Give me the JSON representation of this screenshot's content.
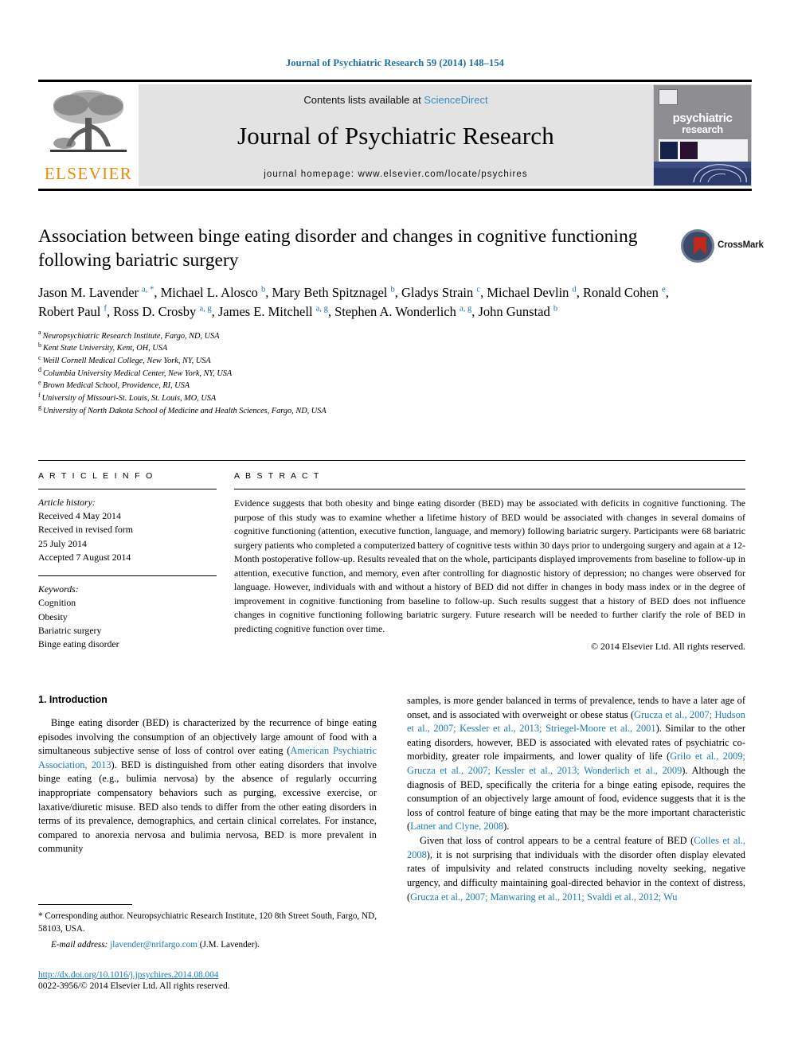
{
  "running_head": "Journal of Psychiatric Research 59 (2014) 148–154",
  "masthead": {
    "contents_prefix": "Contents lists available at ",
    "sciencedirect": "ScienceDirect",
    "journal_title": "Journal of Psychiatric Research",
    "homepage": "journal homepage: www.elsevier.com/locate/psychires",
    "publisher_wordmark": "ELSEVIER",
    "cover_title_line1": "psychiatric",
    "cover_title_line2": "research"
  },
  "article": {
    "title": "Association between binge eating disorder and changes in cognitive functioning following bariatric surgery",
    "crossmark_label": "CrossMark",
    "authors_html": "Jason M. Lavender <sup>a, *</sup>, Michael L. Alosco <sup>b</sup>, Mary Beth Spitznagel <sup>b</sup>, Gladys Strain <sup>c</sup>, Michael Devlin <sup>d</sup>, Ronald Cohen <sup>e</sup>, Robert Paul <sup>f</sup>, Ross D. Crosby <sup>a, g</sup>, James E. Mitchell <sup>a, g</sup>, Stephen A. Wonderlich <sup>a, g</sup>, John Gunstad <sup>b</sup>",
    "affiliations": [
      {
        "marker": "a",
        "text": "Neuropsychiatric Research Institute, Fargo, ND, USA"
      },
      {
        "marker": "b",
        "text": "Kent State University, Kent, OH, USA"
      },
      {
        "marker": "c",
        "text": "Weill Cornell Medical College, New York, NY, USA"
      },
      {
        "marker": "d",
        "text": "Columbia University Medical Center, New York, NY, USA"
      },
      {
        "marker": "e",
        "text": "Brown Medical School, Providence, RI, USA"
      },
      {
        "marker": "f",
        "text": "University of Missouri-St. Louis, St. Louis, MO, USA"
      },
      {
        "marker": "g",
        "text": "University of North Dakota School of Medicine and Health Sciences, Fargo, ND, USA"
      }
    ]
  },
  "article_info": {
    "heading": "A R T I C L E   I N F O",
    "history_label": "Article history:",
    "history_lines": [
      "Received 4 May 2014",
      "Received in revised form",
      "25 July 2014",
      "Accepted 7 August 2014"
    ],
    "keywords_label": "Keywords:",
    "keywords": [
      "Cognition",
      "Obesity",
      "Bariatric surgery",
      "Binge eating disorder"
    ]
  },
  "abstract": {
    "heading": "A B S T R A C T",
    "text": "Evidence suggests that both obesity and binge eating disorder (BED) may be associated with deficits in cognitive functioning. The purpose of this study was to examine whether a lifetime history of BED would be associated with changes in several domains of cognitive functioning (attention, executive function, language, and memory) following bariatric surgery. Participants were 68 bariatric surgery patients who completed a computerized battery of cognitive tests within 30 days prior to undergoing surgery and again at a 12-Month postoperative follow-up. Results revealed that on the whole, participants displayed improvements from baseline to follow-up in attention, executive function, and memory, even after controlling for diagnostic history of depression; no changes were observed for language. However, individuals with and without a history of BED did not differ in changes in body mass index or in the degree of improvement in cognitive functioning from baseline to follow-up. Such results suggest that a history of BED does not influence changes in cognitive functioning following bariatric surgery. Future research will be needed to further clarify the role of BED in predicting cognitive function over time.",
    "copyright": "© 2014 Elsevier Ltd. All rights reserved."
  },
  "introduction": {
    "section_number_title": "1. Introduction",
    "left_paragraph_html": "Binge eating disorder (BED) is characterized by the recurrence of binge eating episodes involving the consumption of an objectively large amount of food with a simultaneous subjective sense of loss of control over eating (<span class=\"ref\">American Psychiatric Association, 2013</span>). BED is distinguished from other eating disorders that involve binge eating (e.g., bulimia nervosa) by the absence of regularly occurring inappropriate compensatory behaviors such as purging, excessive exercise, or laxative/diuretic misuse. BED also tends to differ from the other eating disorders in terms of its prevalence, demographics, and certain clinical correlates. For instance, compared to anorexia nervosa and bulimia nervosa, BED is more prevalent in community",
    "right_paragraph1_html": "samples, is more gender balanced in terms of prevalence, tends to have a later age of onset, and is associated with overweight or obese status (<span class=\"ref\">Grucza et al., 2007; Hudson et al., 2007; Kessler et al., 2013; Striegel-Moore et al., 2001</span>). Similar to the other eating disorders, however, BED is associated with elevated rates of psychiatric co-morbidity, greater role impairments, and lower quality of life (<span class=\"ref\">Grilo et al., 2009; Grucza et al., 2007; Kessler et al., 2013; Wonderlich et al., 2009</span>). Although the diagnosis of BED, specifically the criteria for a binge eating episode, requires the consumption of an objectively large amount of food, evidence suggests that it is the loss of control feature of binge eating that may be the more important characteristic (<span class=\"ref\">Latner and Clyne, 2008</span>).",
    "right_paragraph2_html": "Given that loss of control appears to be a central feature of BED (<span class=\"ref\">Colles et al., 2008</span>), it is not surprising that individuals with the disorder often display elevated rates of impulsivity and related constructs including novelty seeking, negative urgency, and difficulty maintaining goal-directed behavior in the context of distress, (<span class=\"ref\">Grucza et al., 2007; Manwaring et al., 2011; Svaldi et al., 2012; Wu</span>"
  },
  "footer": {
    "corresponding_html": "* Corresponding author. Neuropsychiatric Research Institute, 120 8th Street South, Fargo, ND, 58103, USA.",
    "email_label": "E-mail address:",
    "email": "jlavender@nrifargo.com",
    "email_suffix": "(J.M. Lavender).",
    "doi": "http://dx.doi.org/10.1016/j.jpsychires.2014.08.004",
    "issn_copyright": "0022-3956/© 2014 Elsevier Ltd. All rights reserved."
  },
  "colors": {
    "link_blue": "#1a7bb9",
    "elsevier_orange": "#ED8B00",
    "band_gray": "#e3e3e3"
  }
}
